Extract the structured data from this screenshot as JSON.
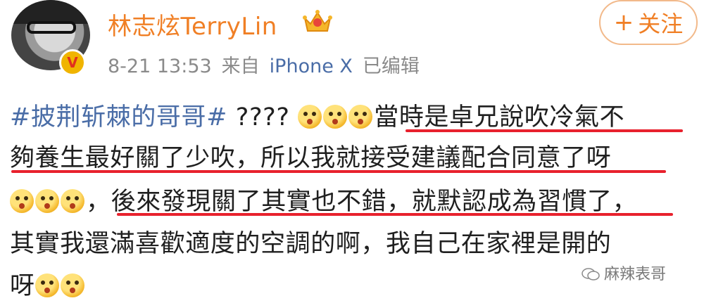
{
  "header": {
    "username": "林志炫TerryLin",
    "date": "8-21 13:53",
    "source_prefix": "来自",
    "device": "iPhone X",
    "edited": "已编辑",
    "follow_label": "关注",
    "follow_plus": "+"
  },
  "post": {
    "hashtag": "#披荆斩棘的哥哥#",
    "question": " ???? ",
    "line1_text": "當時是卓兄說吹冷氣不",
    "line2_text": "夠養生最好關了少吹，所以我就接受建議配合同意了呀",
    "line3_prefix": "，",
    "line3_text": "後來發現關了其實也不錯，就默認成為習慣了，",
    "line4_text": "其實我還滿喜歡適度的空調的啊，我自己在家裡是開的",
    "line5_text": "呀"
  },
  "watermark": {
    "text": "麻辣表哥"
  },
  "colors": {
    "username": "#f07f25",
    "link": "#4a6da7",
    "underline": "#e8212d",
    "meta": "#8a8a8a"
  }
}
